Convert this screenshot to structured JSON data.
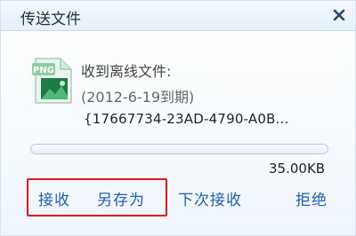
{
  "window": {
    "title": "传送文件",
    "close_icon": "close-icon"
  },
  "file": {
    "icon": "png-file-icon",
    "icon_label": "PNG",
    "status": "收到离线文件:",
    "expiry": "(2012-6-19到期)",
    "name": "{17667734-23AD-4790-A0B...",
    "size": "35.00KB",
    "progress": 0.0
  },
  "actions": {
    "accept": "接收",
    "save_as": "另存为",
    "next_time": "下次接收",
    "reject": "拒绝"
  },
  "colors": {
    "link": "#1f5fb6",
    "highlight_border": "#e2191c",
    "progress_fill": "#2a7fd0"
  }
}
